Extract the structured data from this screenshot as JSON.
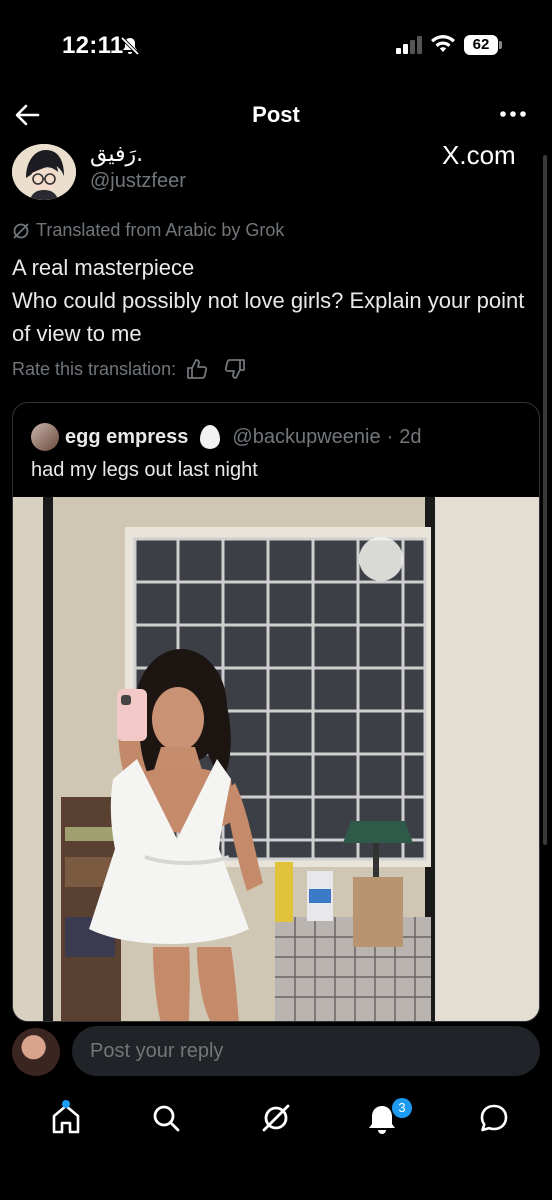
{
  "status_bar": {
    "time": "12:11",
    "battery": "62",
    "icons": [
      "bell-slash-icon",
      "signal-icon",
      "wifi-icon",
      "battery-icon"
    ]
  },
  "header": {
    "title": "Post"
  },
  "post": {
    "display_name": "رَفيق.",
    "handle": "@justzfeer",
    "source_badge": "X.com",
    "translated_label": "Translated from Arabic by Grok",
    "text_line1": "A real masterpiece",
    "text_line2": "Who could possibly not love girls? Explain your point of view to me",
    "rate_label": "Rate this translation:"
  },
  "quote": {
    "name": "egg empress",
    "handle": "@backupweenie",
    "sep": "·",
    "time": "2d",
    "text": "had my legs out last night"
  },
  "reply": {
    "placeholder": "Post your reply"
  },
  "tabbar": {
    "notification_count": "3",
    "tabs": [
      "home-icon",
      "search-icon",
      "grok-icon",
      "notifications-icon",
      "messages-icon"
    ]
  },
  "colors": {
    "background": "#000000",
    "text": "#e7e9ea",
    "muted": "#71767b",
    "accent": "#1d9bf0",
    "border": "#2f3336",
    "input_bg": "#202327"
  }
}
